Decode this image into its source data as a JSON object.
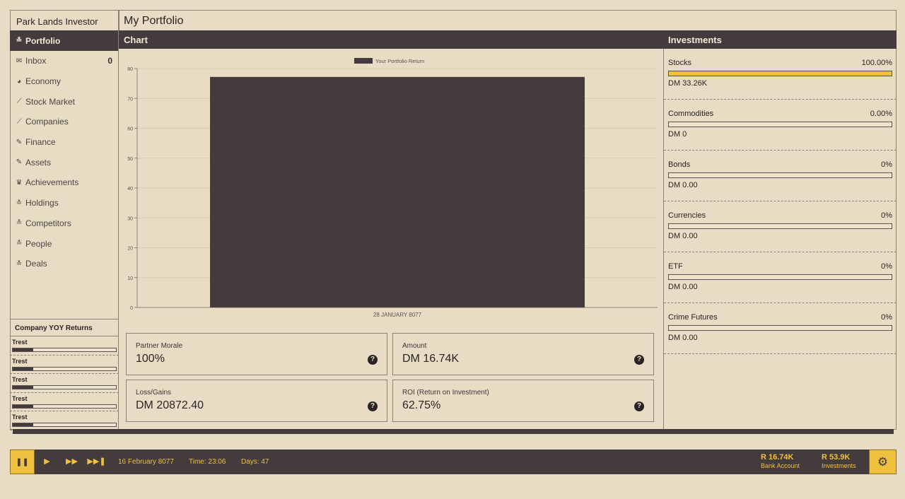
{
  "app": {
    "title": "Park Lands Investor",
    "page_title": "My Portfolio"
  },
  "sidebar": {
    "items": [
      {
        "icon": "portfolio-icon",
        "glyph": "≛",
        "label": "Portfolio",
        "active": true
      },
      {
        "icon": "envelope-icon",
        "glyph": "✉",
        "label": "Inbox",
        "count": "0"
      },
      {
        "icon": "pie-chart-icon",
        "glyph": "◕",
        "label": "Economy"
      },
      {
        "icon": "line-chart-icon",
        "glyph": "⟋",
        "label": "Stock Market"
      },
      {
        "icon": "line-chart-icon",
        "glyph": "⟋",
        "label": "Companies"
      },
      {
        "icon": "paperclip-icon",
        "glyph": "✎",
        "label": "Finance"
      },
      {
        "icon": "paperclip-icon",
        "glyph": "✎",
        "label": "Assets"
      },
      {
        "icon": "trophy-icon",
        "glyph": "♛",
        "label": "Achievements"
      },
      {
        "icon": "portfolio-icon",
        "glyph": "≛",
        "label": "Holdings"
      },
      {
        "icon": "portfolio-icon",
        "glyph": "≛",
        "label": "Competitors"
      },
      {
        "icon": "portfolio-icon",
        "glyph": "≛",
        "label": "People"
      },
      {
        "icon": "portfolio-icon",
        "glyph": "≛",
        "label": "Deals"
      }
    ],
    "yoy_title": "Company YOY Returns",
    "yoy": [
      {
        "name": "Trest",
        "fill": 0.2
      },
      {
        "name": "Trest",
        "fill": 0.2
      },
      {
        "name": "Trest",
        "fill": 0.2
      },
      {
        "name": "Trest",
        "fill": 0.2
      },
      {
        "name": "Trest",
        "fill": 0.2
      }
    ]
  },
  "chart_section": {
    "title": "Chart"
  },
  "chart_data": {
    "type": "bar",
    "categories": [
      "28 JANUARY 8077"
    ],
    "series": [
      {
        "name": "Your Portfolio Return",
        "values": [
          77.2
        ]
      }
    ],
    "ylim": [
      0,
      80
    ],
    "yticks": [
      0,
      10,
      20,
      30,
      40,
      50,
      60,
      70,
      80
    ],
    "legend": "top",
    "grid": true,
    "bar_color": "#433b3c"
  },
  "stats": [
    {
      "label": "Partner Morale",
      "value": "100%"
    },
    {
      "label": "Amount",
      "value": "DM 16.74K"
    },
    {
      "label": "Loss/Gains",
      "value": "DM 20872.40"
    },
    {
      "label": "ROI (Return on Investment)",
      "value": "62.75%"
    }
  ],
  "investments": {
    "title": "Investments",
    "items": [
      {
        "name": "Stocks",
        "percent": "100.00%",
        "value": "DM 33.26K",
        "fill": 1.0
      },
      {
        "name": "Commodities",
        "percent": "0.00%",
        "value": "DM 0",
        "fill": 0
      },
      {
        "name": "Bonds",
        "percent": "0%",
        "value": "DM 0.00",
        "fill": 0
      },
      {
        "name": "Currencies",
        "percent": "0%",
        "value": "DM 0.00",
        "fill": 0
      },
      {
        "name": "ETF",
        "percent": "0%",
        "value": "DM 0.00",
        "fill": 0
      },
      {
        "name": "Crime Futures",
        "percent": "0%",
        "value": "DM 0.00",
        "fill": 0
      }
    ]
  },
  "bottom_bar": {
    "date": "16 February 8077",
    "time": "Time: 23:06",
    "days": "Days: 47",
    "bank_amount": "R 16.74K",
    "bank_label": "Bank Account",
    "investments_amount": "R 53.9K",
    "investments_label": "Investments"
  },
  "colors": {
    "accent": "#f0c040",
    "dark": "#433b3c",
    "background": "#e8dcc4"
  }
}
